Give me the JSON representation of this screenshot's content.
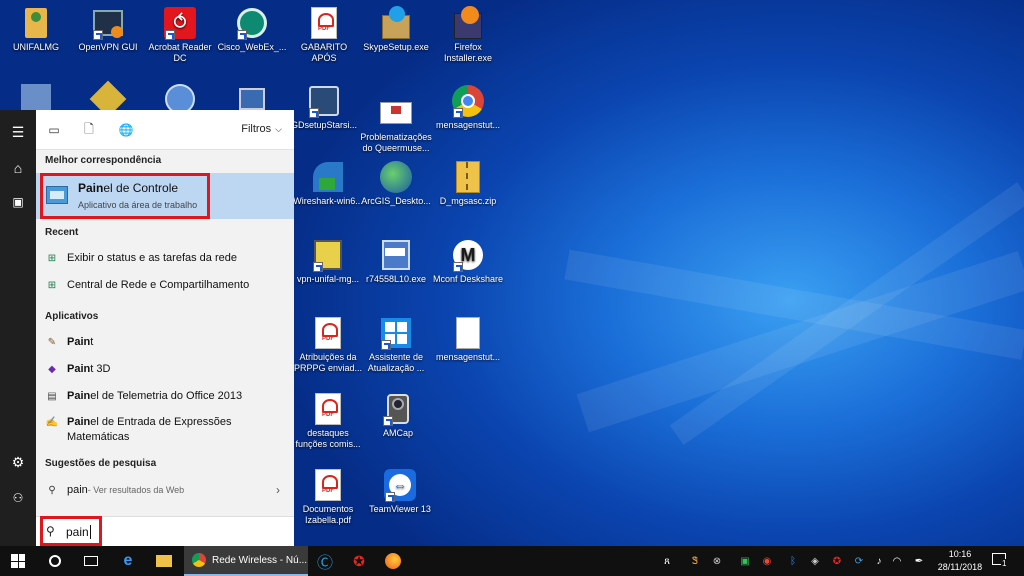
{
  "desktop": {
    "icons": [
      {
        "label": "UNIFALMG"
      },
      {
        "label": "OpenVPN GUI"
      },
      {
        "label": "Acrobat Reader DC"
      },
      {
        "label": "Cisco_WebEx_..."
      },
      {
        "label": "GABARITO APÓS RECURSOS - Jo..."
      },
      {
        "label": "SkypeSetup.exe"
      },
      {
        "label": "Firefox Installer.exe"
      },
      {
        "label": "GDsetupStarsi..."
      },
      {
        "label": "Problematizações do Queermuse..."
      },
      {
        "label": "mensagenstut..."
      },
      {
        "label": "Wireshark-win6..."
      },
      {
        "label": "ArcGIS_Deskto..."
      },
      {
        "label": "D_mgsasc.zip"
      },
      {
        "label": "vpn-unifal-mg..."
      },
      {
        "label": "r74558L10.exe"
      },
      {
        "label": "Mconf Deskshare"
      },
      {
        "label": "Atribuições da PRPPG enviad..."
      },
      {
        "label": "Assistente de Atualização ..."
      },
      {
        "label": "mensagenstut..."
      },
      {
        "label": "destaques funções comis..."
      },
      {
        "label": "AMCap"
      },
      {
        "label": "Documentos Izabella.pdf"
      },
      {
        "label": "TeamViewer 13"
      }
    ]
  },
  "start_menu": {
    "filters_label": "Filtros",
    "best_match_header": "Melhor correspondência",
    "best_match": {
      "match": "Pain",
      "rest": "el de Controle",
      "subtitle": "Aplicativo da área de trabalho"
    },
    "recent_header": "Recent",
    "recent": [
      {
        "label": "Exibir o status e as tarefas da rede"
      },
      {
        "label": "Central de Rede e Compartilhamento"
      }
    ],
    "apps_header": "Aplicativos",
    "apps": [
      {
        "match": "Pain",
        "rest": "t"
      },
      {
        "match": "Pain",
        "rest": "t 3D"
      },
      {
        "match": "Pain",
        "rest": "el de Telemetria do Office 2013"
      },
      {
        "match": "Pain",
        "rest": "el de Entrada de Expressões Matemáticas"
      }
    ],
    "suggestions_header": "Sugestões de pesquisa",
    "suggestion": {
      "term": "pain",
      "hint": " - Ver resultados da Web"
    },
    "search_value": "pain"
  },
  "taskbar": {
    "active_window": "Rede Wireless - Nú...",
    "time": "10:16",
    "date": "28/11/2018",
    "notification_count": "1"
  },
  "colors": {
    "highlight": "#bdd7f3",
    "annotation_red": "#e0161e",
    "taskbar": "#101010"
  }
}
